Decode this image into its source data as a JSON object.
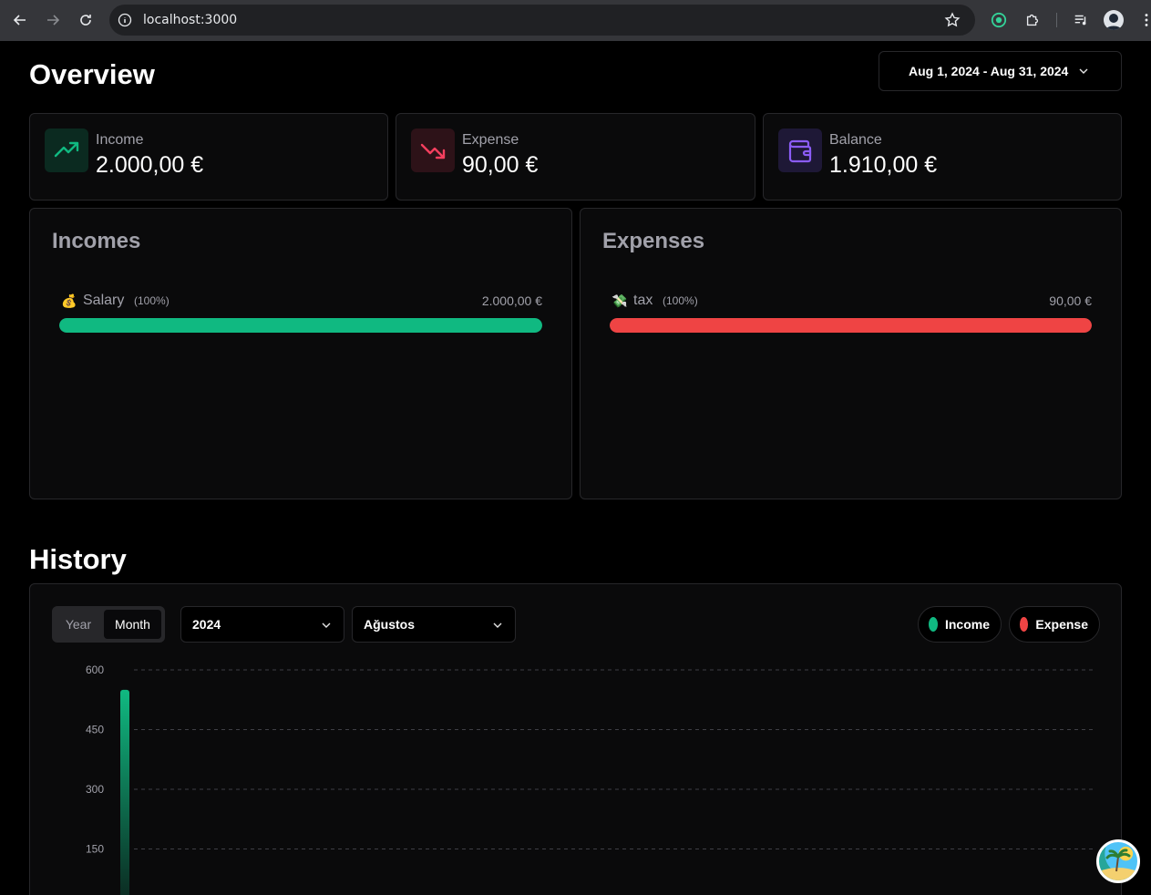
{
  "browser": {
    "url": "localhost:3000"
  },
  "overview": {
    "title": "Overview",
    "date_range": "Aug 1, 2024 - Aug 31, 2024",
    "cards": [
      {
        "label": "Income",
        "value": "2.000,00 €",
        "icon": "trending-up-icon",
        "color": "#10b981"
      },
      {
        "label": "Expense",
        "value": "90,00 €",
        "icon": "trending-down-icon",
        "color": "#f43f5e"
      },
      {
        "label": "Balance",
        "value": "1.910,00 €",
        "icon": "wallet-icon",
        "color": "#8b5cf6"
      }
    ]
  },
  "incomes": {
    "title": "Incomes",
    "items": [
      {
        "emoji": "💰",
        "name": "Salary",
        "percent": "(100%)",
        "amount": "2.000,00 €",
        "fill": 1.0,
        "color": "#10b981"
      }
    ]
  },
  "expenses": {
    "title": "Expenses",
    "items": [
      {
        "emoji": "💸",
        "name": "tax",
        "percent": "(100%)",
        "amount": "90,00 €",
        "fill": 1.0,
        "color": "#ef4444"
      }
    ]
  },
  "history": {
    "title": "History",
    "toggle": {
      "year": "Year",
      "month": "Month",
      "selected": "Month"
    },
    "year_select": "2024",
    "month_select": "Ağustos",
    "legend": [
      {
        "label": "Income",
        "color": "#10b981"
      },
      {
        "label": "Expense",
        "color": "#ef4444"
      }
    ]
  },
  "chart_data": {
    "type": "bar",
    "ylim": [
      0,
      600
    ],
    "yticks": [
      600,
      450,
      300,
      150
    ],
    "grid": true,
    "x": [
      1
    ],
    "series": [
      {
        "name": "Income",
        "color": "#10b981",
        "values": [
          550
        ]
      }
    ]
  }
}
